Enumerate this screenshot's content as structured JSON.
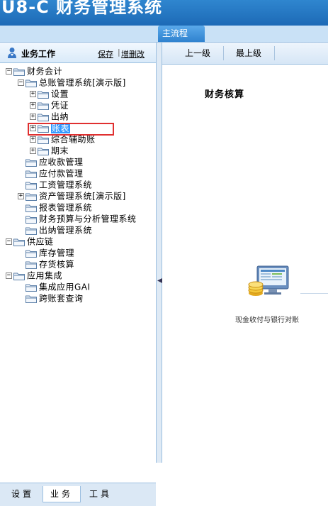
{
  "app": {
    "logo_text": "U8-C 财务管理系统"
  },
  "top_tabs": {
    "main_flow": "主流程"
  },
  "left_panel": {
    "title": "业务工作",
    "save_link": "保存",
    "edit_link": "增删改",
    "tree": [
      {
        "label": "财务会计",
        "expander": "−"
      },
      {
        "label": "总账管理系统[演示版]",
        "expander": "−"
      },
      {
        "label": "设置",
        "expander": "+"
      },
      {
        "label": "凭证",
        "expander": "+"
      },
      {
        "label": "出纳",
        "expander": "+"
      },
      {
        "label": "账表",
        "expander": "+",
        "selected": true
      },
      {
        "label": "综合辅助账",
        "expander": "+"
      },
      {
        "label": "期末",
        "expander": "+"
      },
      {
        "label": "应收款管理",
        "expander": ""
      },
      {
        "label": "应付款管理",
        "expander": ""
      },
      {
        "label": "工资管理系统",
        "expander": ""
      },
      {
        "label": "资产管理系统[演示版]",
        "expander": "+"
      },
      {
        "label": "报表管理系统",
        "expander": ""
      },
      {
        "label": "财务预算与分析管理系统",
        "expander": ""
      },
      {
        "label": "出纳管理系统",
        "expander": ""
      },
      {
        "label": "供应链",
        "expander": "−"
      },
      {
        "label": "库存管理",
        "expander": ""
      },
      {
        "label": "存货核算",
        "expander": ""
      },
      {
        "label": "应用集成",
        "expander": "−"
      },
      {
        "label": "集成应用GAI",
        "expander": ""
      },
      {
        "label": "跨账套查询",
        "expander": ""
      }
    ],
    "bottom_tabs": [
      "设置",
      "业务",
      "工具"
    ],
    "active_bottom_tab": "业务"
  },
  "right_panel": {
    "toolbar": {
      "up_one": "上一级",
      "top_level": "最上级"
    },
    "section_title": "财务核算",
    "flow_item_caption": "现金收付与银行对账"
  },
  "colors": {
    "header": "#1d6ab6",
    "selection": "#3399ff",
    "annotation_box": "#e03030"
  }
}
